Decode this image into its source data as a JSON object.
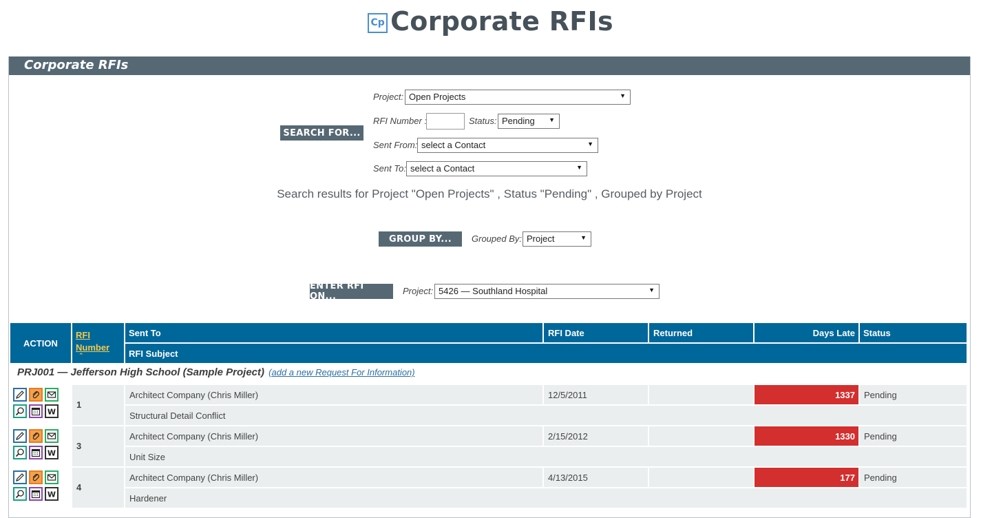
{
  "title": {
    "logo": "Cp",
    "text": "Corporate RFIs"
  },
  "panel": {
    "header": "Corporate RFIs"
  },
  "search": {
    "button": "SEARCH FOR...",
    "project_label": "Project:",
    "project_value": "Open Projects",
    "rfi_number_label": "RFI Number :",
    "rfi_number_value": "",
    "status_label": "Status:",
    "status_value": "Pending",
    "sent_from_label": "Sent From:",
    "sent_from_value": "select a Contact",
    "sent_to_label": "Sent To:",
    "sent_to_value": "select a Contact",
    "results_text": "Search results for Project \"Open Projects\" , Status  \"Pending\" , Grouped by Project"
  },
  "group_by": {
    "button": "GROUP BY...",
    "label": "Grouped By:",
    "value": "Project"
  },
  "enter_rfi": {
    "button": "ENTER RFI ON...",
    "label": "Project:",
    "value": "5426 — Southland Hospital"
  },
  "table": {
    "headers": {
      "action": "ACTION",
      "rfi_number_line1": "RFI",
      "rfi_number_line2": "Number",
      "sent_to": "Sent To",
      "rfi_subject": "RFI Subject",
      "rfi_date": "RFI Date",
      "returned": "Returned",
      "days_late": "Days Late",
      "status": "Status"
    },
    "group": {
      "title": "PRJ001 — Jefferson High School (Sample Project)",
      "link": "(add a new Request For Information)"
    },
    "rows": [
      {
        "number": "1",
        "sent_to": "Architect Company (Chris Miller)",
        "subject": "Structural Detail Conflict",
        "date": "12/5/2011",
        "returned": "",
        "days_late": "1337",
        "status": "Pending"
      },
      {
        "number": "3",
        "sent_to": "Architect Company (Chris Miller)",
        "subject": "Unit Size",
        "date": "2/15/2012",
        "returned": "",
        "days_late": "1330",
        "status": "Pending"
      },
      {
        "number": "4",
        "sent_to": "Architect Company (Chris Miller)",
        "subject": "Hardener",
        "date": "4/13/2015",
        "returned": "",
        "days_late": "177",
        "status": "Pending"
      }
    ],
    "action_icons": [
      "edit-icon",
      "attachment-icon",
      "email-icon",
      "view-icon",
      "calendar-icon",
      "word-icon"
    ]
  },
  "colors": {
    "header_dark": "#566873",
    "table_header": "#00679a",
    "late_red": "#d32f2f",
    "row_bg": "#eaeeee",
    "sort_link": "#f2c94c"
  }
}
